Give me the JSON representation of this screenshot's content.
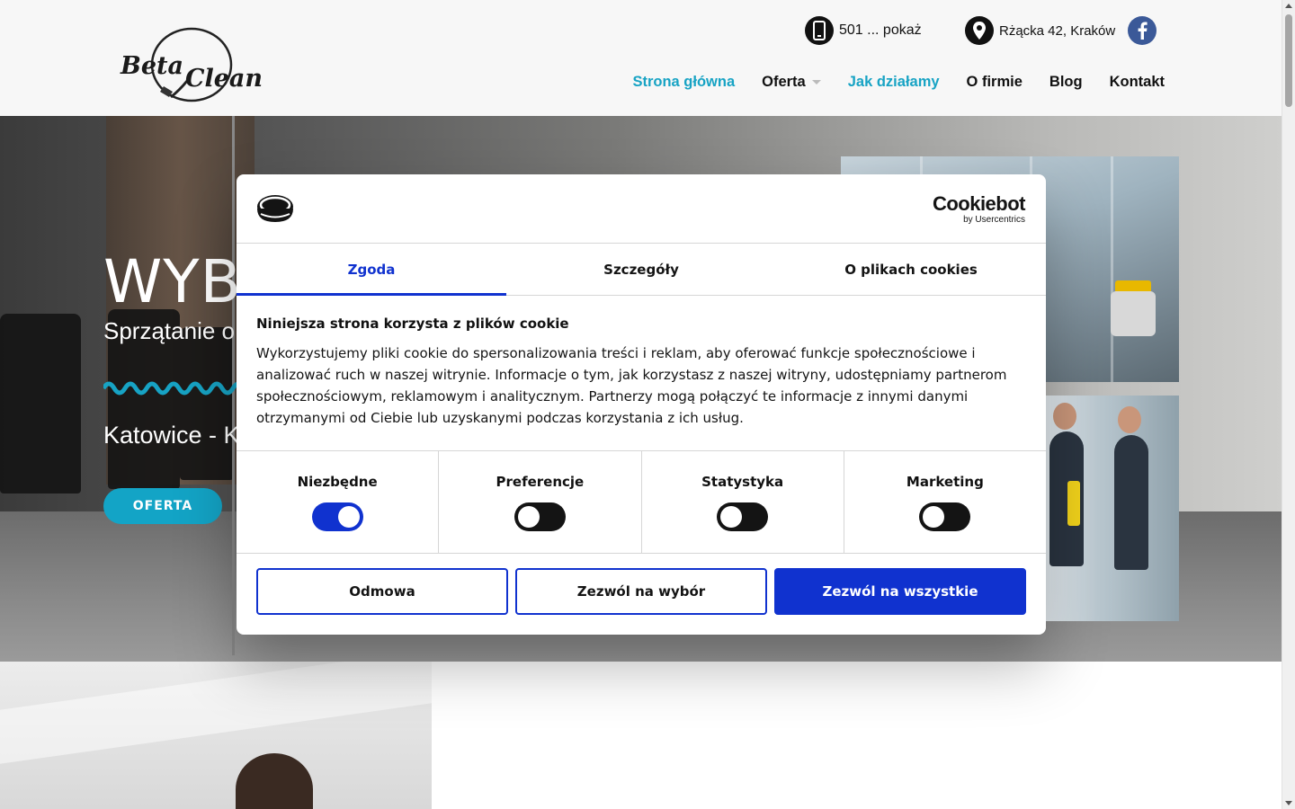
{
  "header": {
    "logo_text": "Beta Clean",
    "phone": "501 ... pokaż",
    "address": "Rżącka 42, Kraków",
    "nav": [
      {
        "label": "Strona główna",
        "active": true
      },
      {
        "label": "Oferta",
        "active": false,
        "has_dropdown": true
      },
      {
        "label": "Jak działamy",
        "active": true
      },
      {
        "label": "O firmie",
        "active": false
      },
      {
        "label": "Blog",
        "active": false
      },
      {
        "label": "Kontakt",
        "active": false
      }
    ]
  },
  "hero": {
    "title": "WYB",
    "subtitle": "Sprzątanie o",
    "city": "Katowice - K",
    "button": "OFERTA"
  },
  "cookie": {
    "brand": "Cookiebot",
    "brand_sub": "by Usercentrics",
    "tabs": [
      "Zgoda",
      "Szczegóły",
      "O plikach cookies"
    ],
    "active_tab": 0,
    "heading": "Niniejsza strona korzysta z plików cookie",
    "body": "Wykorzystujemy pliki cookie do spersonalizowania treści i reklam, aby oferować funkcje społecznościowe i analizować ruch w naszej witrynie. Informacje o tym, jak korzystasz z naszej witryny, udostępniamy partnerom społecznościowym, reklamowym i analitycznym. Partnerzy mogą połączyć te informacje z innymi danymi otrzymanymi od Ciebie lub uzyskanymi podczas korzystania z ich usług.",
    "toggles": [
      {
        "label": "Niezbędne",
        "on": true
      },
      {
        "label": "Preferencje",
        "on": false
      },
      {
        "label": "Statystyka",
        "on": false
      },
      {
        "label": "Marketing",
        "on": false
      }
    ],
    "buttons": {
      "deny": "Odmowa",
      "allow_selection": "Zezwól na wybór",
      "allow_all": "Zezwól na wszystkie"
    }
  },
  "colors": {
    "accent_teal": "#17a3c4",
    "cookie_blue": "#1032cf",
    "facebook": "#3b5998"
  }
}
